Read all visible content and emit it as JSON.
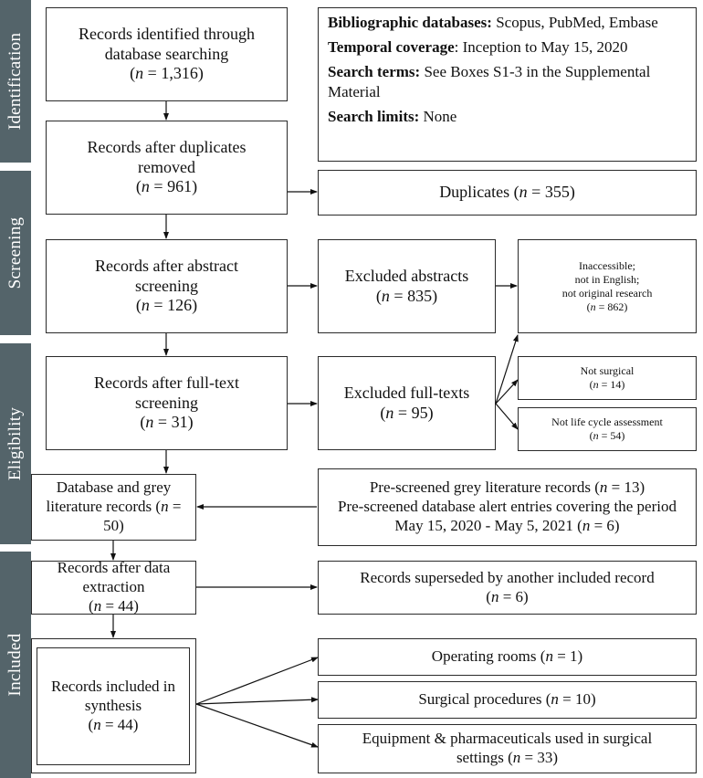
{
  "phases": [
    {
      "label": "Identification"
    },
    {
      "label": "Screening"
    },
    {
      "label": "Eligibility"
    },
    {
      "label": "Included"
    }
  ],
  "search_info": {
    "databases_label": "Bibliographic databases:",
    "databases_value": " Scopus, PubMed, Embase",
    "coverage_label": "Temporal coverage",
    "coverage_value": ": Inception to May 15, 2020",
    "terms_label": "Search terms:",
    "terms_value": " See Boxes S1-3 in the Supplemental Material",
    "limits_label": "Search limits:",
    "limits_value": " None"
  },
  "main_flow": {
    "identified": {
      "text": "Records identified through database searching",
      "n": "1,316"
    },
    "dedup": {
      "text": "Records after duplicates removed",
      "n": "961"
    },
    "abstract": {
      "text": "Records after abstract screening",
      "n": "126"
    },
    "fulltext": {
      "text": "Records after full-text screening",
      "n": "31"
    },
    "grey": {
      "text": "Database and grey literature records (",
      "n": "50"
    },
    "extraction": {
      "text": "Records after data extraction",
      "n": "44"
    },
    "synthesis": {
      "text": "Records included in synthesis",
      "n": "44"
    }
  },
  "side": {
    "duplicates": {
      "text": "Duplicates (",
      "n": "355"
    },
    "excluded_abstracts": {
      "text": "Excluded abstracts",
      "n": "835"
    },
    "abstract_reasons": {
      "line1": "Inaccessible;",
      "line2": "not in English;",
      "line3": "not original research",
      "n": "862"
    },
    "excluded_fulltexts": {
      "text": "Excluded full-texts",
      "n": "95"
    },
    "not_surgical": {
      "text": "Not surgical",
      "n": "14"
    },
    "not_lca": {
      "text": "Not life cycle assessment",
      "n": "54"
    },
    "prescreened": {
      "line1": "Pre-screened grey literature records (",
      "n1": "13",
      "line2": "Pre-screened database alert entries covering the period May 15, 2020 - May 5, 2021  (",
      "n2": "6"
    },
    "superseded": {
      "text": "Records superseded by another included record",
      "n": "6"
    },
    "operating_rooms": {
      "text": "Operating rooms (",
      "n": "1"
    },
    "surgical_procedures": {
      "text": "Surgical procedures (",
      "n": "10"
    },
    "equipment": {
      "text": "Equipment & pharmaceuticals used in surgical settings (",
      "n": "33"
    }
  },
  "n_symbol": "n",
  "colors": {
    "phase_bar": "#54646a",
    "border": "#2a2a2a"
  }
}
